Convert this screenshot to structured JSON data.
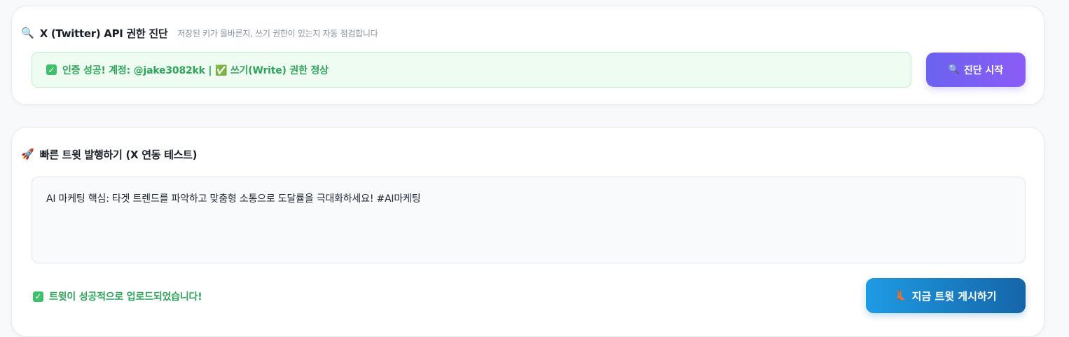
{
  "diagnostics": {
    "icon": "🔍",
    "icon_name": "magnifier-icon",
    "title": "X (Twitter) API 권한 진단",
    "subtitle": "저장된 키가 올바른지, 쓰기 권한이 있는지 자동 점검합니다",
    "status_text": "인증 성공! 계정: @jake3082kk | ✅ 쓰기(Write) 권한 정상",
    "button_icon": "🔍",
    "button_label": "진단 시작",
    "colors": {
      "status_bg": "#eefcf2",
      "status_text": "#2ea45b",
      "button_start": "#6a62f0",
      "button_end": "#8b5cf6"
    }
  },
  "quick_tweet": {
    "icon": "🚀",
    "icon_name": "rocket-icon",
    "title": "빠른 트윗 발행하기 (X 연동 테스트)",
    "tweet_text": "AI 마케팅 핵심: 타겟 트렌드를 파악하고 맞춤형 소통으로 도달률을 극대화하세요! #AI마케팅",
    "result_text": "트윗이 성공적으로 업로드되었습니다!",
    "button_icon": "👢",
    "button_label": "지금 트윗 게시하기",
    "colors": {
      "button_start": "#1e9be4",
      "button_end": "#1565a8"
    }
  }
}
